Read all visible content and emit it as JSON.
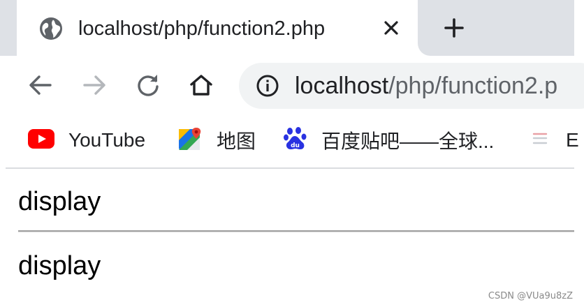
{
  "tab": {
    "title": "localhost/php/function2.php",
    "favicon": "globe-icon",
    "close_icon": "close-icon",
    "new_tab_icon": "plus-icon"
  },
  "toolbar": {
    "back_icon": "arrow-left-icon",
    "forward_icon": "arrow-right-icon",
    "reload_icon": "reload-icon",
    "home_icon": "home-icon",
    "info_icon": "info-icon",
    "url_host": "localhost",
    "url_path": "/php/function2.p"
  },
  "bookmarks": [
    {
      "label": "YouTube",
      "icon": "youtube-icon"
    },
    {
      "label": "地图",
      "icon": "maps-icon"
    },
    {
      "label": "百度贴吧——全球...",
      "icon": "baidu-icon"
    },
    {
      "label": "E",
      "icon": "bookmark-icon"
    }
  ],
  "content": {
    "line1": "display",
    "line2": "display"
  },
  "watermark": "CSDN @VUa9u8zZ",
  "colors": {
    "tabstrip_bg": "#dee1e6",
    "omnibox_bg": "#f1f3f4",
    "youtube_red": "#ff0000",
    "baidu_blue": "#2932e1"
  }
}
